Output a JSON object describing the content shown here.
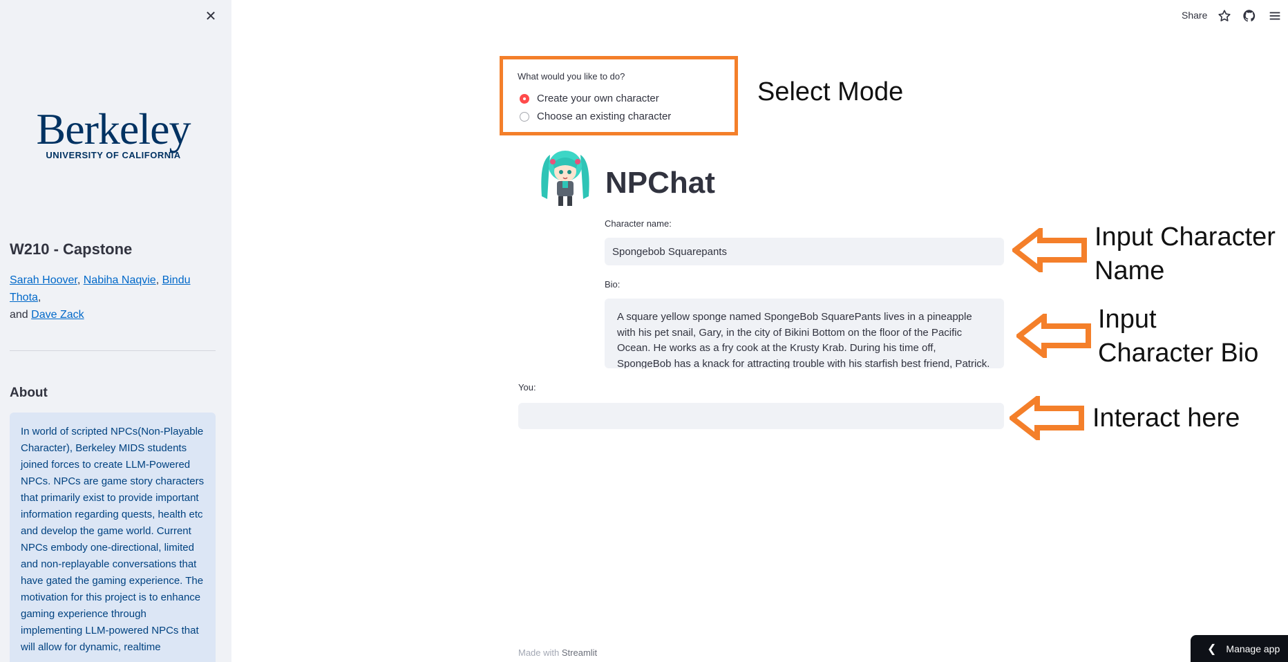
{
  "sidebar": {
    "close_glyph": "✕",
    "logo_main": "Berkeley",
    "logo_sub": "UNIVERSITY OF CALIFORNIA",
    "title": "W210 - Capstone",
    "authors": [
      "Sarah Hoover",
      "Nabiha Naqvie",
      "Bindu Thota",
      "Dave Zack"
    ],
    "authors_and": "and",
    "about_heading": "About",
    "about_text": "In world of scripted NPCs(Non-Playable Character), Berkeley MIDS students joined forces to create LLM-Powered NPCs. NPCs are game story characters that primarily exist to provide important information regarding quests, health etc and develop the game world. Current NPCs embody one-directional, limited and non-replayable conversations that have gated the gaming experience. The motivation for this project is to enhance gaming experience through implementing LLM-powered NPCs that will allow for dynamic, realtime"
  },
  "header": {
    "share_label": "Share",
    "icons": [
      "star-icon",
      "github-icon",
      "menu-icon"
    ]
  },
  "mode": {
    "question": "What would you like to do?",
    "options": [
      "Create your own character",
      "Choose an existing character"
    ],
    "selected": "Create your own character"
  },
  "app": {
    "title": "NPChat",
    "character_name_label": "Character name:",
    "character_name_value": "Spongebob Squarepants",
    "bio_label": "Bio:",
    "bio_value": "A square yellow sponge named SpongeBob SquarePants lives in a pineapple with his pet snail, Gary, in the city of Bikini Bottom on the floor of the Pacific Ocean. He works as a fry cook at the Krusty Krab. During his time off, SpongeBob has a knack for attracting trouble with his starfish best friend, Patrick. Arrogant",
    "you_label": "You:",
    "you_value": ""
  },
  "annotations": {
    "select_mode": "Select Mode",
    "input_name_line1": "Input Character",
    "input_name_line2": "Name",
    "input_bio_line1": "Input",
    "input_bio_line2": "Character Bio",
    "interact": "Interact here",
    "color": "#f47f2a"
  },
  "footer": {
    "made_with": "Made with",
    "brand": "Streamlit",
    "manage_app": "Manage app"
  },
  "colors": {
    "sidebar_bg": "#f0f2f6",
    "accent_radio": "#ff4b4b",
    "link": "#0068c9",
    "info_bg": "#dce6f5"
  }
}
